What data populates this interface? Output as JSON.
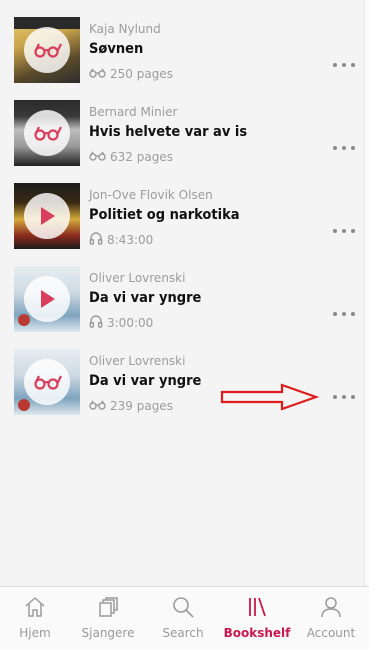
{
  "books": [
    {
      "author": "Kaja Nylund",
      "title": "Søvnen",
      "meta": "250 pages",
      "meta_icon": "glasses-icon",
      "cover_icon": "glasses-icon",
      "cover_colors": [
        "#2d2d2d",
        "#c9a44a",
        "#e5c86a"
      ]
    },
    {
      "author": "Bernard Minier",
      "title": "Hvis helvete var av is",
      "meta": "632 pages",
      "meta_icon": "glasses-icon",
      "cover_icon": "glasses-icon",
      "cover_colors": [
        "#1f1f1f",
        "#bdbdbd",
        "#7a7a7a"
      ]
    },
    {
      "author": "Jon-Ove Flovik Olsen",
      "title": "Politiet og narkotika",
      "meta": "8:43:00",
      "meta_icon": "headphones-icon",
      "cover_icon": "play-icon",
      "cover_colors": [
        "#1c1c1c",
        "#d4a93a",
        "#8a2a1e"
      ]
    },
    {
      "author": "Oliver Lovrenski",
      "title": "Da vi var yngre",
      "meta": "3:00:00",
      "meta_icon": "headphones-icon",
      "cover_icon": "play-icon",
      "cover_colors": [
        "#dfe8ee",
        "#b83a32",
        "#7ea4bf"
      ]
    },
    {
      "author": "Oliver Lovrenski",
      "title": "Da vi var yngre",
      "meta": "239 pages",
      "meta_icon": "glasses-icon",
      "cover_icon": "glasses-icon",
      "cover_colors": [
        "#dfe8ee",
        "#b83a32",
        "#7ea4bf"
      ]
    }
  ],
  "tabs": [
    {
      "label": "Hjem",
      "icon": "home-icon"
    },
    {
      "label": "Sjangere",
      "icon": "genres-icon"
    },
    {
      "label": "Search",
      "icon": "search-icon"
    },
    {
      "label": "Bookshelf",
      "icon": "bookshelf-icon",
      "active": true
    },
    {
      "label": "Account",
      "icon": "account-icon"
    }
  ],
  "accent": "#c9184a",
  "annotation_color": "#e01b1b"
}
